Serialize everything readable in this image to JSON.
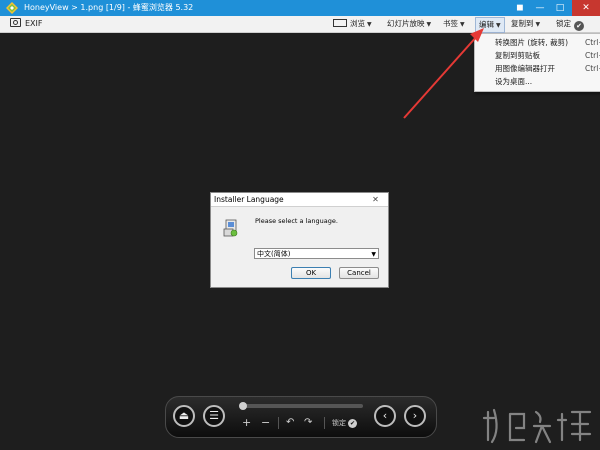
{
  "window": {
    "title": "HoneyView > 1.png [1/9] - 蜂蜜浏览器 5.32",
    "pin_glyph": "◼",
    "minimize_glyph": "—",
    "maximize_glyph": "□",
    "close_glyph": "✕"
  },
  "toolbar": {
    "exif_label": "EXIF",
    "browse_label": "浏览",
    "slideshow_label": "幻灯片放映",
    "bookmark_label": "书签",
    "edit_label": "编辑",
    "copy_label": "复制到",
    "lock_label": "锁定",
    "caret": "▼",
    "check": "✔"
  },
  "edit_menu": {
    "items": [
      {
        "label": "转换图片 (旋转, 裁剪)",
        "shortcut": "Ctrl+"
      },
      {
        "label": "复制到剪贴板",
        "shortcut": "Ctrl+"
      },
      {
        "label": "用图像编辑器打开",
        "shortcut": "Ctrl+"
      },
      {
        "label": "设为桌面...",
        "shortcut": ""
      }
    ]
  },
  "dialog": {
    "title": "Installer Language",
    "close_glyph": "✕",
    "prompt": "Please select a language.",
    "selected_language": "中文(简体)",
    "select_caret": "▼",
    "ok_label": "OK",
    "cancel_label": "Cancel"
  },
  "controls": {
    "eject_glyph": "⏏",
    "menu_glyph": "☰",
    "zoom_in_glyph": "+",
    "zoom_out_glyph": "−",
    "rotate_left_glyph": "↶",
    "rotate_right_glyph": "↷",
    "lock_label": "锁定",
    "lock_check": "✔",
    "prev_glyph": "‹",
    "next_glyph": "›",
    "position": 0
  },
  "colors": {
    "titlebar": "#1f90d8",
    "arrow": "#e53935",
    "background": "#1e1e1e"
  }
}
